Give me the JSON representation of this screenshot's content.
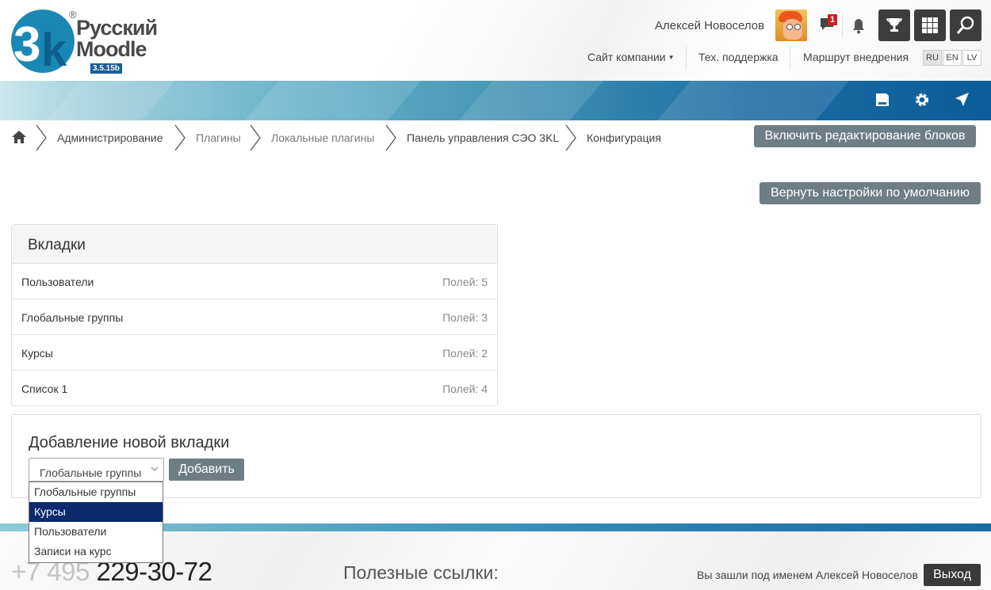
{
  "logo": {
    "line1": "Русский",
    "line2": "Moodle",
    "version": "3.5.15b",
    "reg": "®"
  },
  "header": {
    "user_name": "Алексей Новоселов",
    "messages_badge": "1",
    "links": {
      "company": "Сайт компании",
      "support": "Тех. поддержка",
      "route": "Маршрут внедрения"
    },
    "languages": [
      "RU",
      "EN",
      "LV"
    ]
  },
  "breadcrumb": [
    "Администрирование",
    "Плагины",
    "Локальные плагины",
    "Панель управления СЭО 3KL",
    "Конфигурация"
  ],
  "buttons": {
    "edit_blocks": "Включить редактирование блоков",
    "reset_defaults": "Вернуть настройки по умолчанию",
    "add": "Добавить",
    "exit": "Выход"
  },
  "tabs_card": {
    "title": "Вкладки",
    "rows": [
      {
        "name": "Пользователи",
        "count": "Полей: 5"
      },
      {
        "name": "Глобальные группы",
        "count": "Полей: 3"
      },
      {
        "name": "Курсы",
        "count": "Полей: 2"
      },
      {
        "name": "Список 1",
        "count": "Полей: 4"
      }
    ]
  },
  "add_card": {
    "title": "Добавление новой вкладки",
    "selected": "Глобальные группы",
    "options": [
      "Глобальные группы",
      "Курсы",
      "Пользователи",
      "Записи на курс"
    ],
    "highlighted_index": 1
  },
  "footer": {
    "phone_prefix": "+7 495",
    "phone_number": "229-30-72",
    "links_title": "Полезные ссылки:",
    "logged_in": "Вы зашли под именем Алексей Новоселов"
  },
  "colors": {
    "accent": "#1b6aa2",
    "button_gray": "#6f7e85",
    "dark_button": "#3d3d3d",
    "selected_option": "#0d2a6e",
    "badge": "#d01d1d"
  }
}
